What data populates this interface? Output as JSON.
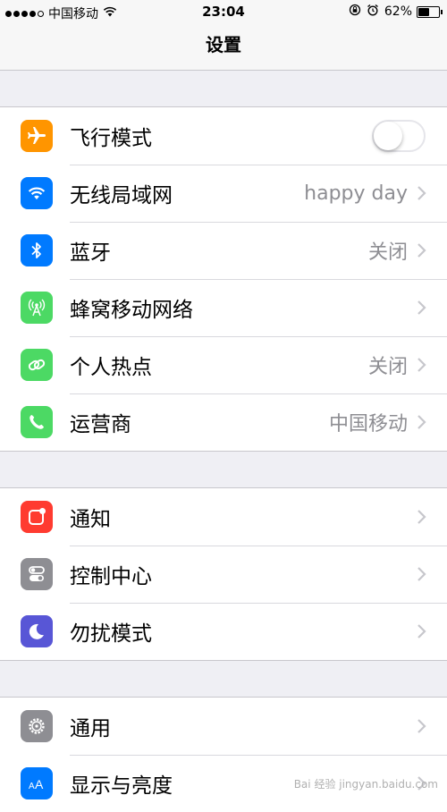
{
  "status": {
    "carrier": "中国移动",
    "time": "23:04",
    "battery": "62%",
    "battery_level": 0.62
  },
  "nav": {
    "title": "设置"
  },
  "groups": [
    [
      {
        "label": "飞行模式",
        "value": "",
        "icon": "airplane-icon",
        "color": "#ff9500",
        "toggle": true
      },
      {
        "label": "无线局域网",
        "value": "happy day",
        "icon": "wifi-icon",
        "color": "#007aff"
      },
      {
        "label": "蓝牙",
        "value": "关闭",
        "icon": "bluetooth-icon",
        "color": "#007aff"
      },
      {
        "label": "蜂窝移动网络",
        "value": "",
        "icon": "cellular-icon",
        "color": "#4cd964"
      },
      {
        "label": "个人热点",
        "value": "关闭",
        "icon": "hotspot-icon",
        "color": "#4cd964"
      },
      {
        "label": "运营商",
        "value": "中国移动",
        "icon": "phone-icon",
        "color": "#4cd964"
      }
    ],
    [
      {
        "label": "通知",
        "value": "",
        "icon": "notification-icon",
        "color": "#ff3b30"
      },
      {
        "label": "控制中心",
        "value": "",
        "icon": "control-center-icon",
        "color": "#8e8e93"
      },
      {
        "label": "勿扰模式",
        "value": "",
        "icon": "moon-icon",
        "color": "#5856d6"
      }
    ],
    [
      {
        "label": "通用",
        "value": "",
        "icon": "gear-icon",
        "color": "#8e8e93"
      },
      {
        "label": "显示与亮度",
        "value": "",
        "icon": "display-icon",
        "color": "#007aff"
      }
    ]
  ],
  "watermark": "Bai 经验 jingyan.baidu.com"
}
